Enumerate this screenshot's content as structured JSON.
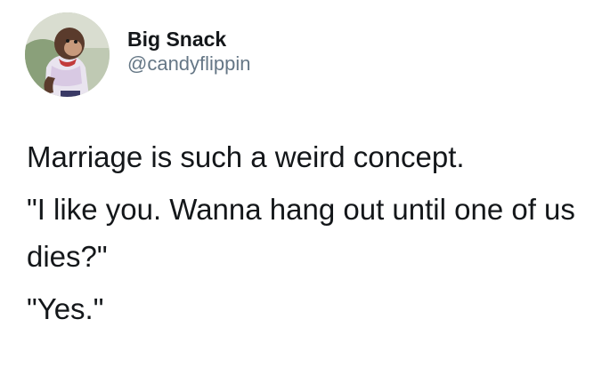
{
  "tweet": {
    "author": {
      "display_name": "Big Snack",
      "handle": "@candyflippin",
      "avatar_icon": "monkey-avatar-icon"
    },
    "paragraphs": [
      "Marriage is such a weird concept.",
      "\"I like you. Wanna hang out until one of us dies?\"",
      "\"Yes.\""
    ]
  },
  "colors": {
    "text_primary": "#14171a",
    "text_secondary": "#657786",
    "background": "#ffffff"
  }
}
